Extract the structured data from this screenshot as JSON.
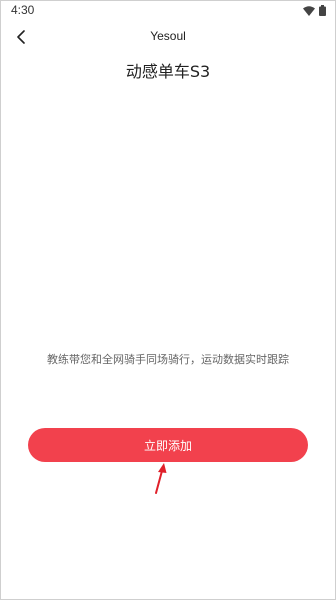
{
  "status_bar": {
    "time": "4:30",
    "icons": [
      "wifi-icon",
      "battery-icon"
    ]
  },
  "app_bar": {
    "back_icon": "chevron-left-icon",
    "title": "Yesoul"
  },
  "device": {
    "name": "动感单车S3",
    "description": "教练带您和全网骑手同场骑行，运动数据实时跟踪"
  },
  "actions": {
    "add_label": "立即添加"
  },
  "annotation": {
    "arrow_icon": "red-arrow-icon"
  },
  "colors": {
    "accent": "#f2414d",
    "arrow": "#e0202a",
    "text_primary": "#222222",
    "text_secondary": "#666666"
  }
}
